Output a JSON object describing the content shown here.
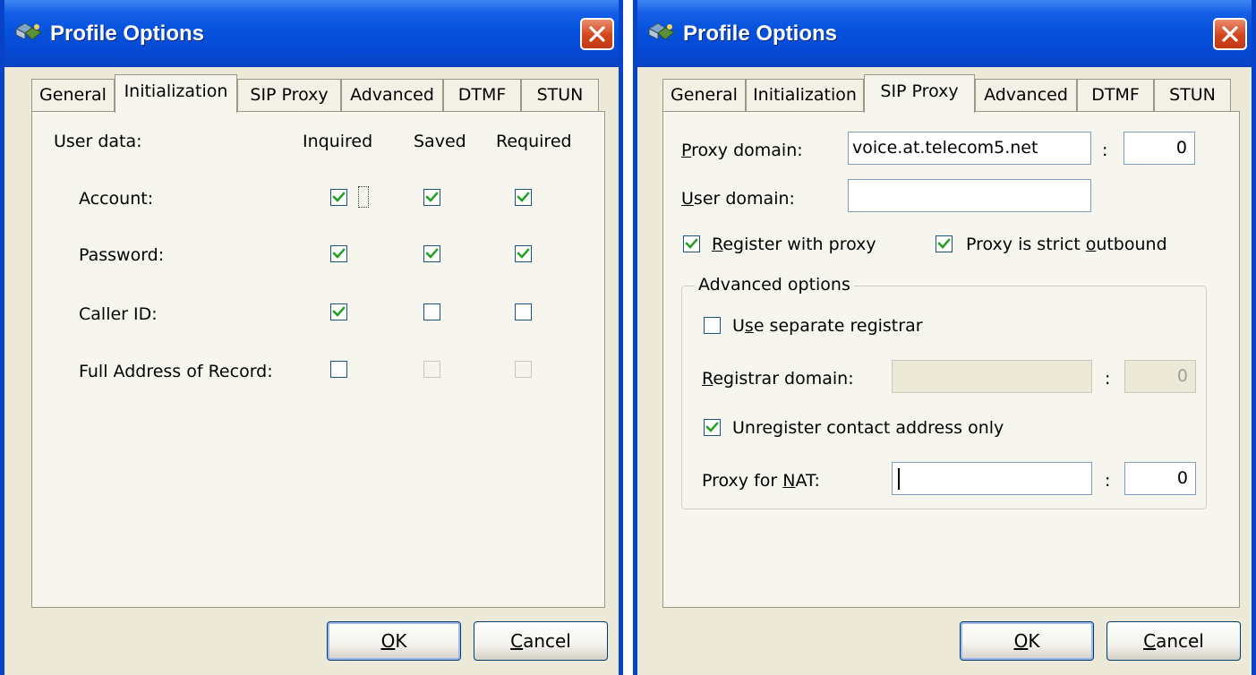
{
  "dialog1": {
    "title": "Profile Options",
    "tabs": [
      "General",
      "Initialization",
      "SIP Proxy",
      "Advanced",
      "DTMF",
      "STUN"
    ],
    "active_tab": "Initialization",
    "user_data_label": "User data:",
    "columns": [
      "Inquired",
      "Saved",
      "Required"
    ],
    "rows": [
      {
        "label": "Account:",
        "inquired": true,
        "saved": true,
        "required": true
      },
      {
        "label": "Password:",
        "inquired": true,
        "saved": true,
        "required": true
      },
      {
        "label": "Caller ID:",
        "inquired": true,
        "saved": false,
        "required": false
      },
      {
        "label": "Full Address of Record:",
        "inquired": false,
        "saved": false,
        "required": false
      }
    ],
    "ok_label": "OK",
    "cancel_label": "Cancel"
  },
  "dialog2": {
    "title": "Profile Options",
    "tabs": [
      "General",
      "Initialization",
      "SIP Proxy",
      "Advanced",
      "DTMF",
      "STUN"
    ],
    "active_tab": "SIP Proxy",
    "proxy_domain": {
      "label_key": "P",
      "label_rest": "roxy domain:",
      "value": "voice.at.telecom5.net",
      "port": "0"
    },
    "user_domain": {
      "label_key": "U",
      "label_rest": "ser domain:",
      "value": ""
    },
    "register_with_proxy": {
      "label_key": "R",
      "label_rest": "egister with proxy",
      "checked": true
    },
    "strict_outbound": {
      "label_pre": "Proxy is strict ",
      "label_key": "o",
      "label_rest": "utbound",
      "checked": true
    },
    "sep": ":",
    "advanced_options": {
      "label": "Advanced options",
      "use_separate_registrar": {
        "label_pre": "U",
        "label_key": "s",
        "label_rest": "e separate registrar",
        "checked": false
      },
      "registrar_domain": {
        "label_key": "R",
        "label_rest": "egistrar domain:",
        "value": "",
        "port": "0",
        "disabled": true
      },
      "unregister_contact_only": {
        "label": "Unregister contact address only",
        "checked": true
      },
      "proxy_for_nat": {
        "label_pre": "Proxy for ",
        "label_key": "N",
        "label_rest": "AT:",
        "value": "",
        "port": "0"
      }
    },
    "ok_label": "OK",
    "cancel_label": "Cancel"
  },
  "ok_key": "O",
  "ok_rest": "K",
  "cancel_key": "C",
  "cancel_rest": "ancel"
}
